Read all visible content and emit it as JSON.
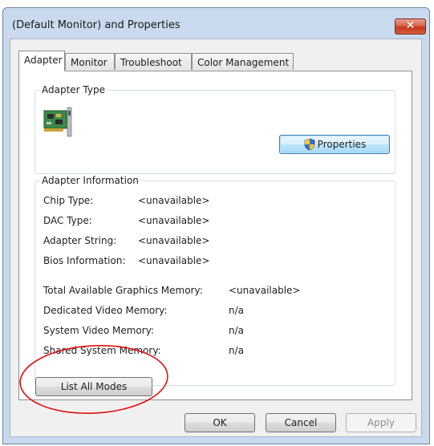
{
  "window": {
    "title": "(Default Monitor) and  Properties",
    "close_glyph": "✕"
  },
  "tabs": [
    {
      "label": "Adapter",
      "active": true
    },
    {
      "label": "Monitor",
      "active": false
    },
    {
      "label": "Troubleshoot",
      "active": false
    },
    {
      "label": "Color Management",
      "active": false
    }
  ],
  "adapter_type": {
    "group_label": "Adapter Type",
    "icon": "graphics-card-icon",
    "properties_button": "Properties",
    "properties_icon": "uac-shield-icon"
  },
  "adapter_info": {
    "group_label": "Adapter Information",
    "rows": [
      {
        "label": "Chip Type:",
        "value": "<unavailable>"
      },
      {
        "label": "DAC Type:",
        "value": "<unavailable>"
      },
      {
        "label": "Adapter String:",
        "value": "<unavailable>"
      },
      {
        "label": "Bios Information:",
        "value": "<unavailable>"
      }
    ],
    "memory_rows": [
      {
        "label": "Total Available Graphics Memory:",
        "value": "<unavailable>"
      },
      {
        "label": "Dedicated Video Memory:",
        "value": "n/a"
      },
      {
        "label": "System Video Memory:",
        "value": "n/a"
      },
      {
        "label": "Shared System Memory:",
        "value": "n/a"
      }
    ]
  },
  "list_all_modes_button": "List All Modes",
  "footer": {
    "ok": "OK",
    "cancel": "Cancel",
    "apply": "Apply"
  },
  "colors": {
    "annotation_circle": "#e01010",
    "frame": "#c9daee",
    "close_button": "#c7472d"
  }
}
